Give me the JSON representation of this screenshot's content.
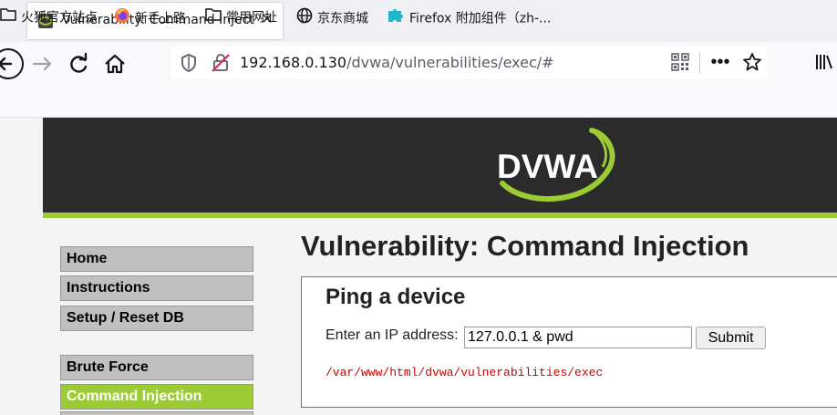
{
  "browser": {
    "tab": {
      "title": "Vulnerability: Command Injection",
      "favicon": "dvwa-icon"
    },
    "new_tab_icon": "plus-icon",
    "url": {
      "host": "192.168.0.130",
      "path": "/dvwa/vulnerabilities/exec/#"
    },
    "bookmarks": [
      {
        "label": "火狐官方站点",
        "icon": "folder-icon"
      },
      {
        "label": "新手上路",
        "icon": "firefox-icon"
      },
      {
        "label": "常用网址",
        "icon": "folder-icon"
      },
      {
        "label": "京东商城",
        "icon": "globe-icon"
      },
      {
        "label": "Firefox 附加组件（zh-...",
        "icon": "puzzle-icon"
      }
    ]
  },
  "dvwa": {
    "logo_text": "DVWA",
    "menu": [
      {
        "label": "Home",
        "active": false
      },
      {
        "label": "Instructions",
        "active": false
      },
      {
        "label": "Setup / Reset DB",
        "active": false
      },
      {
        "label": "Brute Force",
        "active": false
      },
      {
        "label": "Command Injection",
        "active": true
      }
    ],
    "page_title": "Vulnerability: Command Injection",
    "panel": {
      "title": "Ping a device",
      "ip_label": "Enter an IP address:",
      "ip_value": "127.0.0.1 & pwd",
      "submit_label": "Submit",
      "result": "/var/www/html/dvwa/vulnerabilities/exec"
    }
  },
  "colors": {
    "accent_green": "#9ccc33",
    "header_dark": "#2b2b2b",
    "result_red": "#cc0000"
  }
}
